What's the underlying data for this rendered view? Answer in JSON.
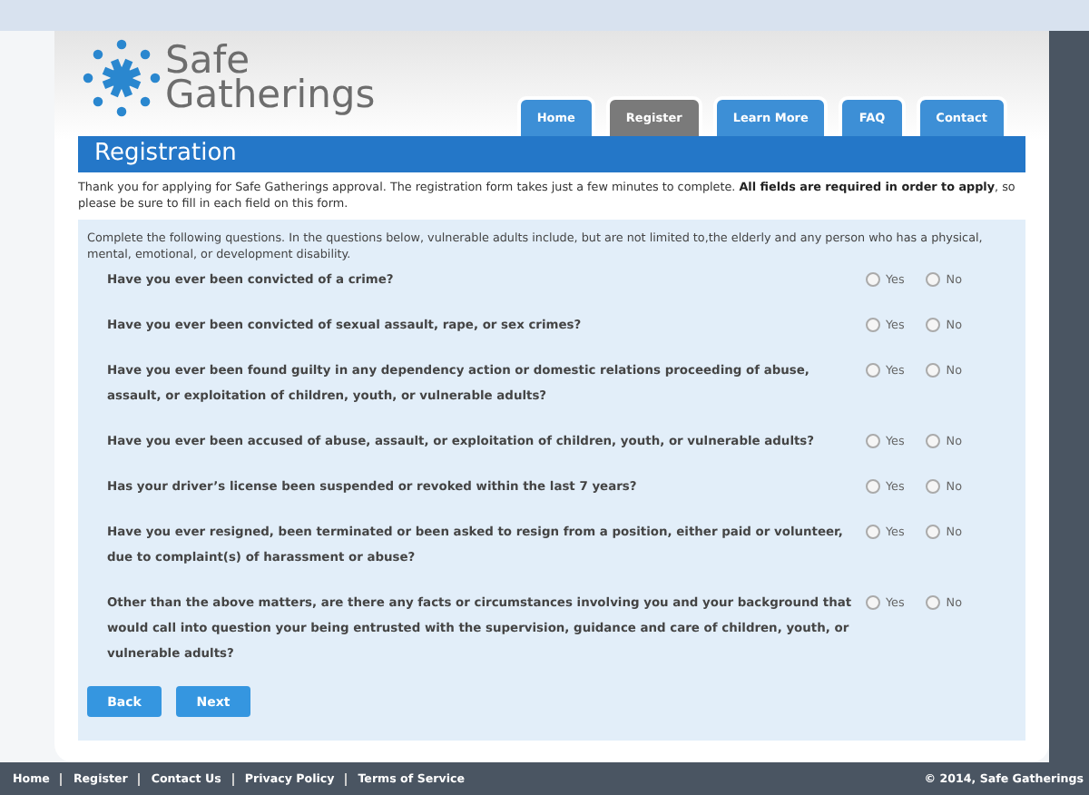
{
  "logo": {
    "lines": [
      "Safe",
      "Gatherings"
    ]
  },
  "tabs": [
    {
      "label": "Home",
      "selected": false
    },
    {
      "label": "Register",
      "selected": true
    },
    {
      "label": "Learn More",
      "selected": false
    },
    {
      "label": "FAQ",
      "selected": false
    },
    {
      "label": "Contact",
      "selected": false
    }
  ],
  "page_title": "Registration",
  "intro": "Thank you for applying for Safe Gatherings approval. The registration form takes just a few minutes to complete. **All fields are required in order to apply**, so please be sure to fill in each field on this form.",
  "form": {
    "instructions": "Complete the following questions. In the questions below, vulnerable adults include, but are not limited to,the elderly and any person who has a physical, mental, emotional, or development disability.",
    "questions": [
      {
        "text": "Have you ever been convicted of a crime?",
        "options": [
          {
            "label": "Yes",
            "selected": false
          },
          {
            "label": "No",
            "selected": false
          }
        ]
      },
      {
        "text": "Have you ever been convicted of sexual assault, rape, or sex crimes?",
        "options": [
          {
            "label": "Yes",
            "selected": false
          },
          {
            "label": "No",
            "selected": false
          }
        ]
      },
      {
        "text": "Have you ever been found guilty in any dependency action or domestic relations proceeding of abuse, assault, or exploitation of children, youth, or vulnerable adults?",
        "options": [
          {
            "label": "Yes",
            "selected": false
          },
          {
            "label": "No",
            "selected": false
          }
        ]
      },
      {
        "text": "Have you ever been accused of abuse, assault, or exploitation of children, youth, or vulnerable adults?",
        "options": [
          {
            "label": "Yes",
            "selected": false
          },
          {
            "label": "No",
            "selected": false
          }
        ]
      },
      {
        "text": "Has your driver’s license been suspended or revoked within the last 7 years?",
        "options": [
          {
            "label": "Yes",
            "selected": false
          },
          {
            "label": "No",
            "selected": false
          }
        ]
      },
      {
        "text": "Have you ever resigned, been terminated or been asked to resign from a position, either paid or volunteer, due to complaint(s) of harassment or abuse?",
        "options": [
          {
            "label": "Yes",
            "selected": false
          },
          {
            "label": "No",
            "selected": false
          }
        ]
      },
      {
        "text": "Other than the above matters, are there any facts or circumstances involving you and your background that would call into question your being entrusted with the supervision, guidance and care of children, youth, or vulnerable adults?",
        "options": [
          {
            "label": "Yes",
            "selected": false
          },
          {
            "label": "No",
            "selected": false
          }
        ]
      }
    ],
    "buttons": [
      "Back",
      "Next"
    ]
  },
  "footer": {
    "links": [
      "Home",
      "Register",
      "Contact Us",
      "Privacy Policy",
      "Terms of Service"
    ],
    "copyright": "© 2014, Safe Gatherings"
  }
}
